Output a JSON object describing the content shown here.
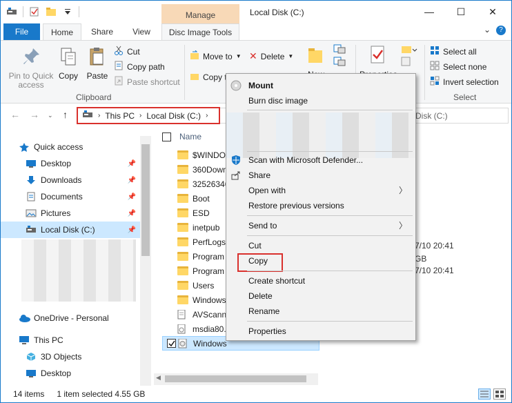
{
  "window": {
    "title": "Local Disk (C:)",
    "context_tab_group": "Manage",
    "controls": {
      "minimize": "—",
      "maximize": "☐",
      "close": "✕"
    }
  },
  "ribbon_tabs": {
    "file": "File",
    "home": "Home",
    "share": "Share",
    "view": "View",
    "disc": "Disc Image Tools",
    "expand": "⌄",
    "help": "?"
  },
  "ribbon": {
    "clipboard": {
      "pin_label": "Pin to Quick access",
      "copy": "Copy",
      "paste": "Paste",
      "cut": "Cut",
      "copy_path": "Copy path",
      "paste_shortcut": "Paste shortcut",
      "group": "Clipboard"
    },
    "organize": {
      "move_to": "Move to",
      "copy_to": "Copy to",
      "delete": "Delete",
      "new": "New",
      "properties": "Properties"
    },
    "select": {
      "select_all": "Select all",
      "select_none": "Select none",
      "invert": "Invert selection",
      "group": "Select"
    }
  },
  "address": {
    "crumb1": "This PC",
    "crumb2": "Local Disk (C:)",
    "search_placeholder": "Disk (C:)"
  },
  "nav": {
    "quick_access": "Quick access",
    "items": [
      "Desktop",
      "Downloads",
      "Documents",
      "Pictures",
      "Local Disk (C:)"
    ],
    "onedrive": "OneDrive - Personal",
    "this_pc": "This PC",
    "pc_items": [
      "3D Objects",
      "Desktop"
    ]
  },
  "files": {
    "column_name": "Name",
    "rows": [
      "$WINDOW",
      "360Down",
      "32526346",
      "Boot",
      "ESD",
      "inetpub",
      "PerfLogs",
      "Program",
      "Program",
      "Users",
      "Windows",
      "AVScanne",
      "msdia80.",
      "Windows"
    ],
    "peek": {
      "date1": "7/10 20:41",
      "size": "GB",
      "date2": "7/10 20:41"
    }
  },
  "status": {
    "count": "14 items",
    "selection": "1 item selected  4.55 GB"
  },
  "context_menu": {
    "mount": "Mount",
    "burn": "Burn disc image",
    "defender": "Scan with Microsoft Defender...",
    "share": "Share",
    "open_with": "Open with",
    "restore": "Restore previous versions",
    "send_to": "Send to",
    "cut": "Cut",
    "copy": "Copy",
    "create_shortcut": "Create shortcut",
    "delete": "Delete",
    "rename": "Rename",
    "properties": "Properties"
  },
  "colors": {
    "accent": "#1979ca",
    "highlight_border": "#d9302c",
    "manage_tab": "#f8d9b7",
    "selection": "#cce8ff"
  }
}
